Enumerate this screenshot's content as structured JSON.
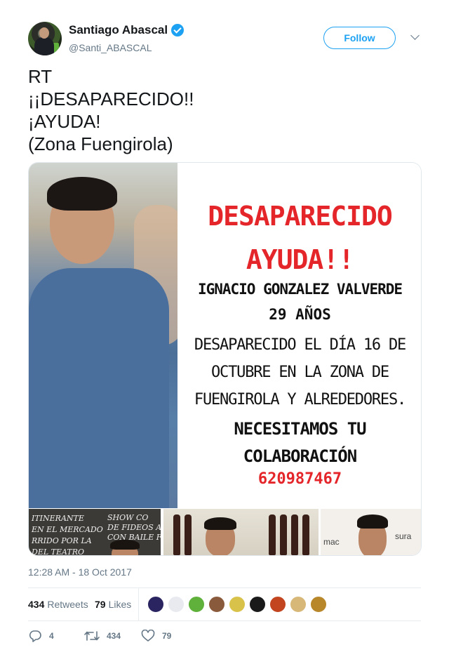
{
  "author": {
    "name": "Santiago Abascal",
    "handle": "@Santi_ABASCAL",
    "verified": true,
    "follow_label": "Follow"
  },
  "tweet": {
    "lines": [
      "RT",
      "¡¡DESAPARECIDO!!",
      "¡AYUDA!",
      "(Zona Fuengirola)"
    ]
  },
  "media": {
    "flyer": {
      "title": "DESAPARECIDO",
      "subtitle": "AYUDA!!",
      "name": "IGNACIO GONZALEZ VALVERDE",
      "age": "29 AÑOS",
      "details": [
        "DESAPARECIDO EL DÍA 16 DE",
        "OCTUBRE EN LA ZONA DE",
        "FUENGIROLA Y ALREDEDORES."
      ],
      "call": [
        "NECESITAMOS TU",
        "COLABORACIÓN"
      ],
      "phone": "620987467"
    },
    "thumb_left_text": [
      "ITINERANTE",
      "EN EL MERCADO",
      "RRIDO POR LA",
      "DEL TEATRO"
    ],
    "thumb_left_text2": [
      "SHOW CO",
      "DE FIDEOS A L",
      "CON BAILE F"
    ],
    "thumb_right_text": "mac",
    "thumb_right_text2": "sura"
  },
  "timestamp": "12:28 AM - 18 Oct 2017",
  "stats": {
    "retweets_count": "434",
    "retweets_label": "Retweets",
    "likes_count": "79",
    "likes_label": "Likes",
    "liker_avatar_colors": [
      "#2a2560",
      "#e8eaf0",
      "#5fb13b",
      "#8a5a3c",
      "#d9c24a",
      "#1a1a1a",
      "#c2451f",
      "#d8b878",
      "#b8872a"
    ]
  },
  "actions": {
    "replies": "4",
    "retweets": "434",
    "likes": "79"
  },
  "colors": {
    "accent": "#1da1f2",
    "muted": "#657786",
    "flyer_red": "#e4262a"
  }
}
